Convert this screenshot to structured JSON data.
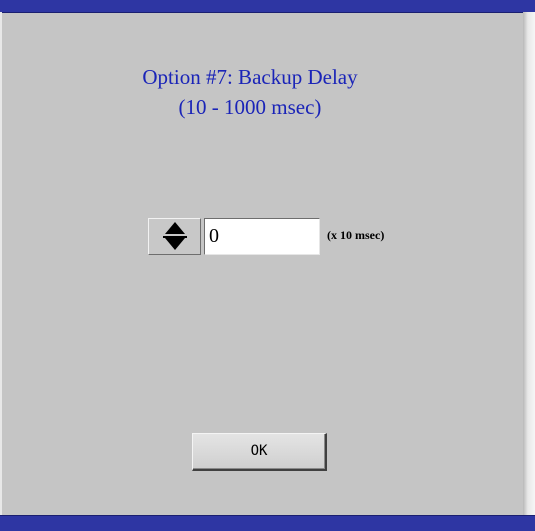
{
  "dialog": {
    "heading_line1": "Option #7: Backup Delay",
    "heading_line2": "(10 - 1000 msec)"
  },
  "spinner": {
    "up_icon": "arrow-up-icon",
    "down_icon": "arrow-down-icon"
  },
  "field": {
    "value": "0",
    "unit_label": "(x 10 msec)"
  },
  "buttons": {
    "ok_label": "OK"
  },
  "colors": {
    "window_bg": "#c5c5c5",
    "title_bar": "#2e36a3",
    "heading_text": "#1a24b8"
  }
}
